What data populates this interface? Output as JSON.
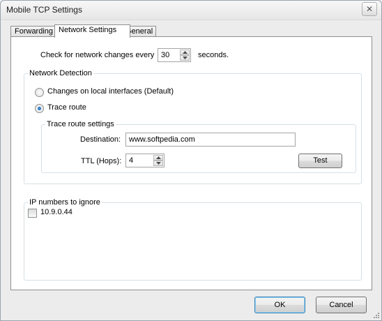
{
  "window": {
    "title": "Mobile TCP Settings"
  },
  "tabs": [
    {
      "label": "Forwarding"
    },
    {
      "label": "Network Settings"
    },
    {
      "label": "General"
    }
  ],
  "check_interval": {
    "prefix": "Check for network changes every",
    "value": "30",
    "suffix": "seconds."
  },
  "network_detection": {
    "legend": "Network Detection",
    "options": [
      {
        "label": "Changes on local interfaces (Default)",
        "selected": false
      },
      {
        "label": "Trace route",
        "selected": true
      }
    ],
    "trace_route": {
      "legend": "Trace route settings",
      "destination_label": "Destination:",
      "destination_value": "www.softpedia.com",
      "ttl_label": "TTL (Hops):",
      "ttl_value": "4",
      "test_button": "Test"
    }
  },
  "ip_ignore": {
    "legend": "IP numbers to ignore",
    "items": [
      {
        "label": "10.9.0.44",
        "checked": false
      }
    ]
  },
  "footer": {
    "ok": "OK",
    "cancel": "Cancel"
  },
  "colors": {
    "radio_dot": "#1a5fb4",
    "default_button_border": "#3c7fb1"
  }
}
